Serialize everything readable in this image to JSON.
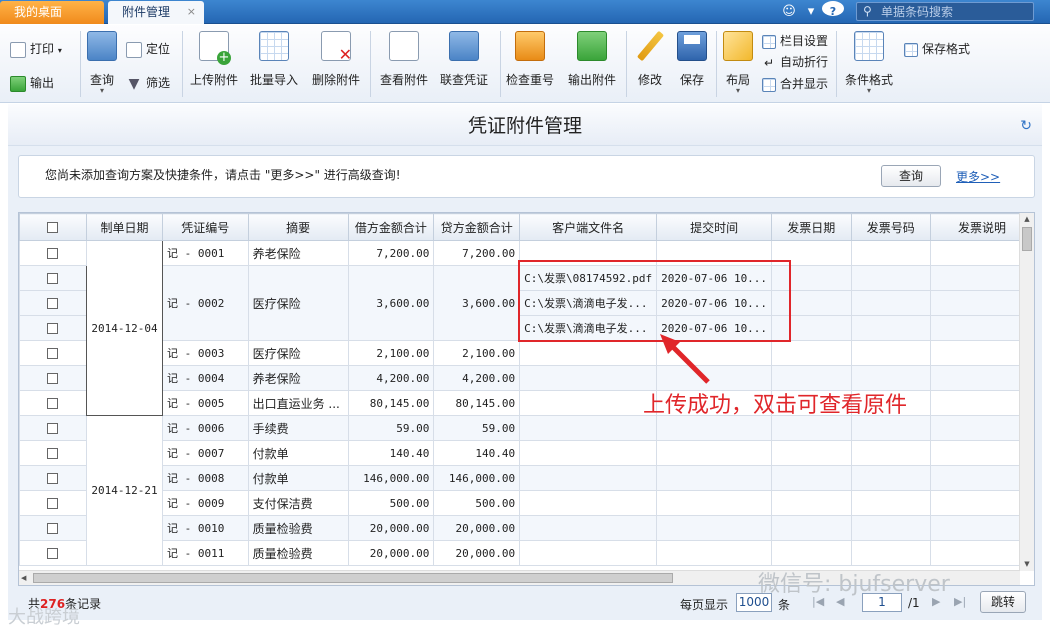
{
  "tabs": {
    "desktop": "我的桌面",
    "active": "附件管理",
    "close": "×"
  },
  "top": {
    "search_placeholder": "单据条码搜索",
    "help": "?",
    "smile": "☺",
    "caret": "▾"
  },
  "toolbar": {
    "print": "打印",
    "export": "输出",
    "query": "查询",
    "locate": "定位",
    "filter": "筛选",
    "upload": "上传附件",
    "batch_import": "批量导入",
    "delete": "删除附件",
    "view": "查看附件",
    "link_voucher": "联查凭证",
    "check_dup": "检查重号",
    "export_att": "输出附件",
    "modify": "修改",
    "save": "保存",
    "layout": "布局",
    "col_setting": "栏目设置",
    "auto_wrap": "自动折行",
    "merge_show": "合并显示",
    "cond_format": "条件格式",
    "save_format": "保存格式"
  },
  "page_title": "凭证附件管理",
  "query": {
    "message": "您尚未添加查询方案及快捷条件，请点击 \"更多>>\" 进行高级查询!",
    "button": "查询",
    "more": "更多>>"
  },
  "table": {
    "headers": [
      "制单日期",
      "凭证编号",
      "摘要",
      "借方金额合计",
      "贷方金额合计",
      "客户端文件名",
      "提交时间",
      "发票日期",
      "发票号码",
      "发票说明"
    ],
    "dates": [
      "2014-12-04",
      "2014-12-21"
    ],
    "rows": [
      {
        "no": "记 - 0001",
        "summary": "养老保险",
        "debit": "7,200.00",
        "credit": "7,200.00",
        "file": "",
        "time": ""
      },
      {
        "no": "记 - 0002",
        "summary": "医疗保险",
        "debit": "3,600.00",
        "credit": "3,600.00",
        "files": [
          "C:\\发票\\08174592.pdf",
          "C:\\发票\\滴滴电子发...",
          "C:\\发票\\滴滴电子发..."
        ],
        "times": [
          "2020-07-06 10...",
          "2020-07-06 10...",
          "2020-07-06 10..."
        ]
      },
      {
        "no": "记 - 0003",
        "summary": "医疗保险",
        "debit": "2,100.00",
        "credit": "2,100.00"
      },
      {
        "no": "记 - 0004",
        "summary": "养老保险",
        "debit": "4,200.00",
        "credit": "4,200.00"
      },
      {
        "no": "记 - 0005",
        "summary": "出口直运业务 ...",
        "debit": "80,145.00",
        "credit": "80,145.00"
      },
      {
        "no": "记 - 0006",
        "summary": "手续费",
        "debit": "59.00",
        "credit": "59.00"
      },
      {
        "no": "记 - 0007",
        "summary": "付款单",
        "debit": "140.40",
        "credit": "140.40"
      },
      {
        "no": "记 - 0008",
        "summary": "付款单",
        "debit": "146,000.00",
        "credit": "146,000.00"
      },
      {
        "no": "记 - 0009",
        "summary": "支付保洁费",
        "debit": "500.00",
        "credit": "500.00"
      },
      {
        "no": "记 - 0010",
        "summary": "质量检验费",
        "debit": "20,000.00",
        "credit": "20,000.00"
      },
      {
        "no": "记 - 0011",
        "summary": "质量检验费",
        "debit": "20,000.00",
        "credit": "20,000.00"
      }
    ]
  },
  "annotation": "上传成功，双击可查看原件",
  "footer": {
    "prefix": "共",
    "count": "276",
    "suffix": "条记录",
    "per_page_label": "每页显示",
    "per_page": "1000",
    "unit": "条",
    "page": "1",
    "total_pages": "/1",
    "jump": "跳转"
  },
  "watermark": {
    "wechat": "微信号: bjufserver",
    "brand": "大战跨境"
  },
  "colors": {
    "accent": "#2466b3",
    "annotation": "#e0262a",
    "tab_orange": "#f08a1c"
  }
}
